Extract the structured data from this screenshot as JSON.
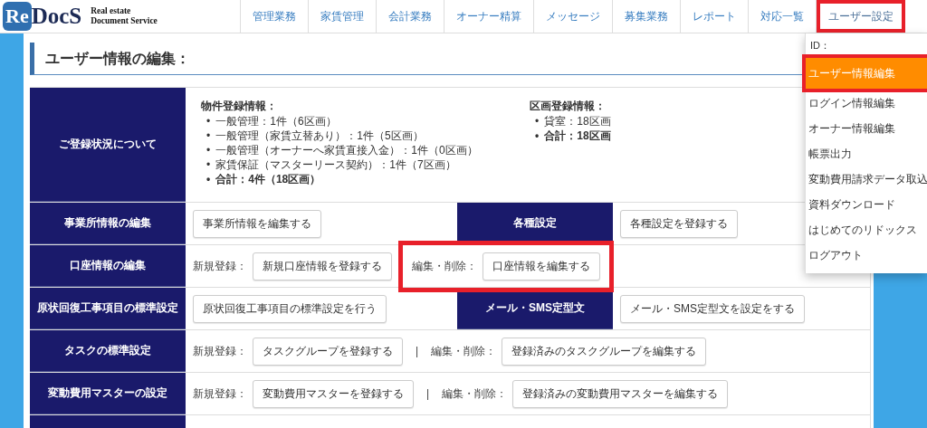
{
  "logo": {
    "mark": "Re",
    "name": "DocS",
    "tagline": [
      "Real estate",
      "Document Service"
    ]
  },
  "nav": {
    "tabs": [
      {
        "label": "管理業務",
        "selected": false,
        "highlighted": false
      },
      {
        "label": "家賃管理",
        "selected": false,
        "highlighted": false
      },
      {
        "label": "会計業務",
        "selected": false,
        "highlighted": false
      },
      {
        "label": "オーナー精算",
        "selected": false,
        "highlighted": false
      },
      {
        "label": "メッセージ",
        "selected": false,
        "highlighted": false
      },
      {
        "label": "募集業務",
        "selected": false,
        "highlighted": false
      },
      {
        "label": "レポート",
        "selected": false,
        "highlighted": false
      },
      {
        "label": "対応一覧",
        "selected": false,
        "highlighted": false
      },
      {
        "label": "ユーザー設定",
        "selected": true,
        "highlighted": true
      }
    ]
  },
  "user_menu": {
    "id_label": "ID：",
    "items": [
      {
        "label": "ユーザー情報編集",
        "selected": true,
        "highlighted": true
      },
      {
        "label": "ログイン情報編集",
        "selected": false,
        "highlighted": false
      },
      {
        "label": "オーナー情報編集",
        "selected": false,
        "highlighted": false
      },
      {
        "label": "帳票出力",
        "selected": false,
        "highlighted": false
      },
      {
        "label": "変動費用請求データ取込",
        "selected": false,
        "highlighted": false
      },
      {
        "label": "資料ダウンロード",
        "selected": false,
        "highlighted": false
      },
      {
        "label": "はじめてのリドックス",
        "selected": false,
        "highlighted": false
      },
      {
        "label": "ログアウト",
        "selected": false,
        "highlighted": false
      }
    ]
  },
  "page_title": "ユーザー情報の編集：",
  "registration": {
    "header": "ご登録状況について",
    "sections": [
      {
        "title": "物件登録情報：",
        "items": [
          {
            "marker": "•",
            "text": "一般管理：1件（6区画）",
            "bold": false
          },
          {
            "marker": "•",
            "text": "一般管理（家賃立替あり）：1件（5区画）",
            "bold": false
          },
          {
            "marker": "•",
            "text": "一般管理（オーナーへ家賃直接入金）：1件（0区画）",
            "bold": false
          },
          {
            "marker": "•",
            "text": "家賃保証（マスターリース契約）：1件（7区画）",
            "bold": false
          },
          {
            "marker": "•",
            "text": "合計：4件（18区画）",
            "bold": true
          }
        ]
      },
      {
        "title": "区画登録情報：",
        "items": [
          {
            "marker": "•",
            "text": "貸室：18区画",
            "bold": false
          },
          {
            "marker": "•",
            "text": "合計：18区画",
            "bold": true
          }
        ]
      }
    ]
  },
  "rows": [
    {
      "cells": [
        {
          "kind": "header",
          "label": "事業所情報の編集"
        },
        {
          "kind": "actions",
          "groups": [
            {
              "highlighted": false,
              "parts": [
                {
                  "kind": "button",
                  "text": "事業所情報を編集する"
                }
              ]
            }
          ]
        },
        {
          "kind": "header",
          "label": "各種設定"
        },
        {
          "kind": "actions",
          "groups": [
            {
              "highlighted": false,
              "parts": [
                {
                  "kind": "button",
                  "text": "各種設定を登録する"
                }
              ]
            }
          ]
        }
      ]
    },
    {
      "cells": [
        {
          "kind": "header",
          "label": "口座情報の編集"
        },
        {
          "kind": "actions",
          "groups": [
            {
              "highlighted": false,
              "parts": [
                {
                  "kind": "label",
                  "text": "新規登録："
                },
                {
                  "kind": "button",
                  "text": "新規口座情報を登録する"
                }
              ]
            },
            {
              "highlighted": true,
              "parts": [
                {
                  "kind": "label",
                  "text": "編集・削除："
                },
                {
                  "kind": "button",
                  "text": "口座情報を編集する"
                }
              ]
            }
          ]
        }
      ]
    },
    {
      "cells": [
        {
          "kind": "header",
          "label": "原状回復工事項目の標準設定"
        },
        {
          "kind": "actions",
          "groups": [
            {
              "highlighted": false,
              "parts": [
                {
                  "kind": "button",
                  "text": "原状回復工事項目の標準設定を行う"
                }
              ]
            }
          ]
        },
        {
          "kind": "header",
          "label": "メール・SMS定型文"
        },
        {
          "kind": "actions",
          "groups": [
            {
              "highlighted": false,
              "parts": [
                {
                  "kind": "button",
                  "text": "メール・SMS定型文を設定をする"
                }
              ]
            }
          ]
        }
      ]
    },
    {
      "cells": [
        {
          "kind": "header",
          "label": "タスクの標準設定"
        },
        {
          "kind": "actions",
          "groups": [
            {
              "highlighted": false,
              "parts": [
                {
                  "kind": "label",
                  "text": "新規登録："
                },
                {
                  "kind": "button",
                  "text": "タスクグループを登録する"
                },
                {
                  "kind": "separator",
                  "text": "|"
                },
                {
                  "kind": "label",
                  "text": "編集・削除："
                },
                {
                  "kind": "button",
                  "text": "登録済みのタスクグループを編集する"
                }
              ]
            }
          ]
        }
      ]
    },
    {
      "cells": [
        {
          "kind": "header",
          "label": "変動費用マスターの設定"
        },
        {
          "kind": "actions",
          "groups": [
            {
              "highlighted": false,
              "parts": [
                {
                  "kind": "label",
                  "text": "新規登録："
                },
                {
                  "kind": "button",
                  "text": "変動費用マスターを登録する"
                },
                {
                  "kind": "separator",
                  "text": "|"
                },
                {
                  "kind": "label",
                  "text": "編集・削除："
                },
                {
                  "kind": "button",
                  "text": "登録済みの変動費用マスターを編集する"
                }
              ]
            }
          ]
        }
      ]
    }
  ]
}
